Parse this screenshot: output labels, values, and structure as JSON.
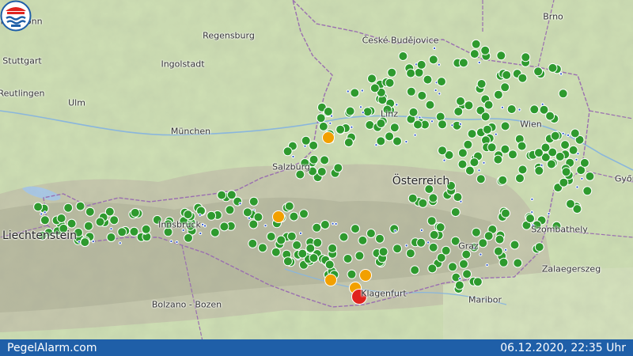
{
  "footer": {
    "site_name": "PegelAlarm.com",
    "timestamp": "06.12.2020, 22:35 Uhr"
  },
  "colors": {
    "normal": "#2e9a2e",
    "warning": "#f2a000",
    "alarm": "#e0231e",
    "small_station": "#2a55c8",
    "footer_bg": "#1f5fa8"
  },
  "cities": [
    {
      "name": "Heilbronn"
    },
    {
      "name": "Regensburg"
    },
    {
      "name": "České Budějovice"
    },
    {
      "name": "Brno"
    },
    {
      "name": "Stuttgart"
    },
    {
      "name": "Ingolstadt"
    },
    {
      "name": "Reutlingen"
    },
    {
      "name": "Ulm"
    },
    {
      "name": "München"
    },
    {
      "name": "Linz"
    },
    {
      "name": "Wien"
    },
    {
      "name": "Salzburg"
    },
    {
      "name": "Österreich"
    },
    {
      "name": "Győr"
    },
    {
      "name": "Liechtenstein"
    },
    {
      "name": "Innsbruck"
    },
    {
      "name": "Szombathely"
    },
    {
      "name": "Graz"
    },
    {
      "name": "Zalaegerszeg"
    },
    {
      "name": "Bolzano - Bozen"
    },
    {
      "name": "Klagenfurt"
    },
    {
      "name": "Maribor"
    }
  ],
  "stations_summary": {
    "status_levels": [
      "normal",
      "warning",
      "alarm"
    ]
  }
}
